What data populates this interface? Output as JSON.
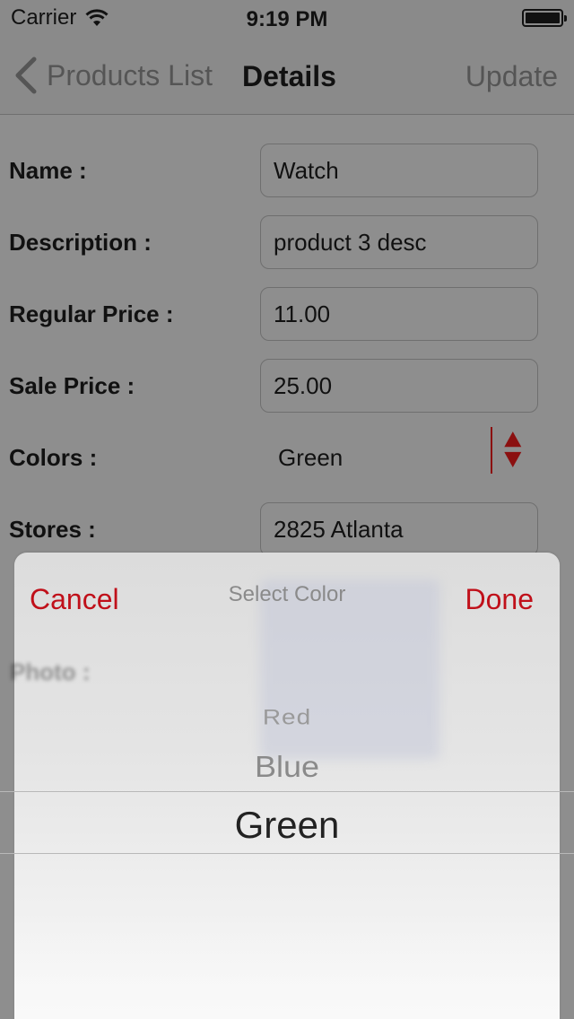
{
  "status_bar": {
    "carrier": "Carrier",
    "time": "9:19 PM",
    "battery_level": 1.0
  },
  "nav": {
    "back_label": "Products List",
    "title": "Details",
    "update_label": "Update"
  },
  "form": {
    "name": {
      "label": "Name :",
      "value": "Watch"
    },
    "description": {
      "label": "Description :",
      "value": "product 3 desc"
    },
    "regular_price": {
      "label": "Regular Price :",
      "value": "11.00"
    },
    "sale_price": {
      "label": "Sale Price :",
      "value": "25.00"
    },
    "colors": {
      "label": "Colors :",
      "value": "Green"
    },
    "stores": {
      "label": "Stores :",
      "value": "2825 Atlanta"
    },
    "photo": {
      "label": "Photo :"
    }
  },
  "picker": {
    "cancel_label": "Cancel",
    "title": "Select Color",
    "done_label": "Done",
    "options": [
      "Red",
      "Blue",
      "Green"
    ],
    "selected": "Green"
  },
  "colors": {
    "accent": "#c0101a",
    "overlay": "#8e8e8e"
  },
  "icons": [
    "wifi-icon",
    "battery-icon",
    "chevron-left-icon",
    "stepper-arrows-icon"
  ]
}
